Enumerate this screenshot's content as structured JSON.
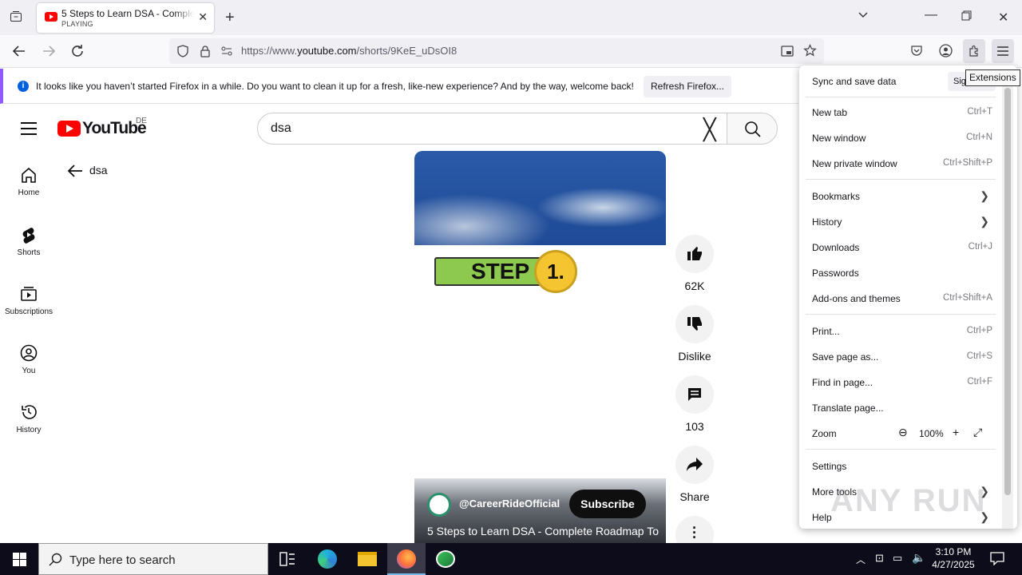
{
  "browser": {
    "tab_title": "5 Steps to Learn DSA - Complete Roadmap To",
    "tab_status": "PLAYING",
    "url_prefix": "https://www.",
    "url_domain": "youtube.com",
    "url_path": "/shorts/9KeE_uDsOI8",
    "tooltip": "Extensions"
  },
  "notification": {
    "message": "It looks like you haven’t started Firefox in a while. Do you want to clean it up for a fresh, like-new experience? And by the way, welcome back!",
    "button": "Refresh Firefox..."
  },
  "youtube": {
    "logo_text": "YouTube",
    "country": "DE",
    "search_value": "dsa",
    "back_label": "dsa",
    "sidebar": [
      {
        "label": "Home",
        "icon": "home-icon"
      },
      {
        "label": "Shorts",
        "icon": "shorts-icon"
      },
      {
        "label": "Subscriptions",
        "icon": "subscriptions-icon"
      },
      {
        "label": "You",
        "icon": "you-icon"
      },
      {
        "label": "History",
        "icon": "history-icon"
      }
    ],
    "video": {
      "step_text": "STEP",
      "step_num": "1.",
      "channel": "@CareerRideOfficial",
      "subscribe": "Subscribe",
      "title": "5 Steps to Learn DSA - Complete Roadmap To"
    },
    "actions": {
      "likes": "62K",
      "dislike": "Dislike",
      "comments": "103",
      "share": "Share"
    }
  },
  "menu": {
    "sync": "Sync and save data",
    "sign_in": "Sign in",
    "items": [
      {
        "label": "New tab",
        "shortcut": "Ctrl+T"
      },
      {
        "label": "New window",
        "shortcut": "Ctrl+N"
      },
      {
        "label": "New private window",
        "shortcut": "Ctrl+Shift+P"
      },
      {
        "label": "Bookmarks",
        "shortcut": ""
      },
      {
        "label": "History",
        "shortcut": ""
      },
      {
        "label": "Downloads",
        "shortcut": "Ctrl+J"
      },
      {
        "label": "Passwords",
        "shortcut": ""
      },
      {
        "label": "Add-ons and themes",
        "shortcut": "Ctrl+Shift+A"
      },
      {
        "label": "Print...",
        "shortcut": "Ctrl+P"
      },
      {
        "label": "Save page as...",
        "shortcut": "Ctrl+S"
      },
      {
        "label": "Find in page...",
        "shortcut": "Ctrl+F"
      },
      {
        "label": "Translate page...",
        "shortcut": ""
      },
      {
        "label": "Zoom",
        "shortcut": ""
      },
      {
        "label": "Settings",
        "shortcut": ""
      },
      {
        "label": "More tools",
        "shortcut": ""
      },
      {
        "label": "Help",
        "shortcut": ""
      }
    ],
    "zoom_value": "100%"
  },
  "taskbar": {
    "search_placeholder": "Type here to search",
    "time": "3:10 PM",
    "date": "4/27/2025"
  },
  "watermark": "ANY RUN"
}
